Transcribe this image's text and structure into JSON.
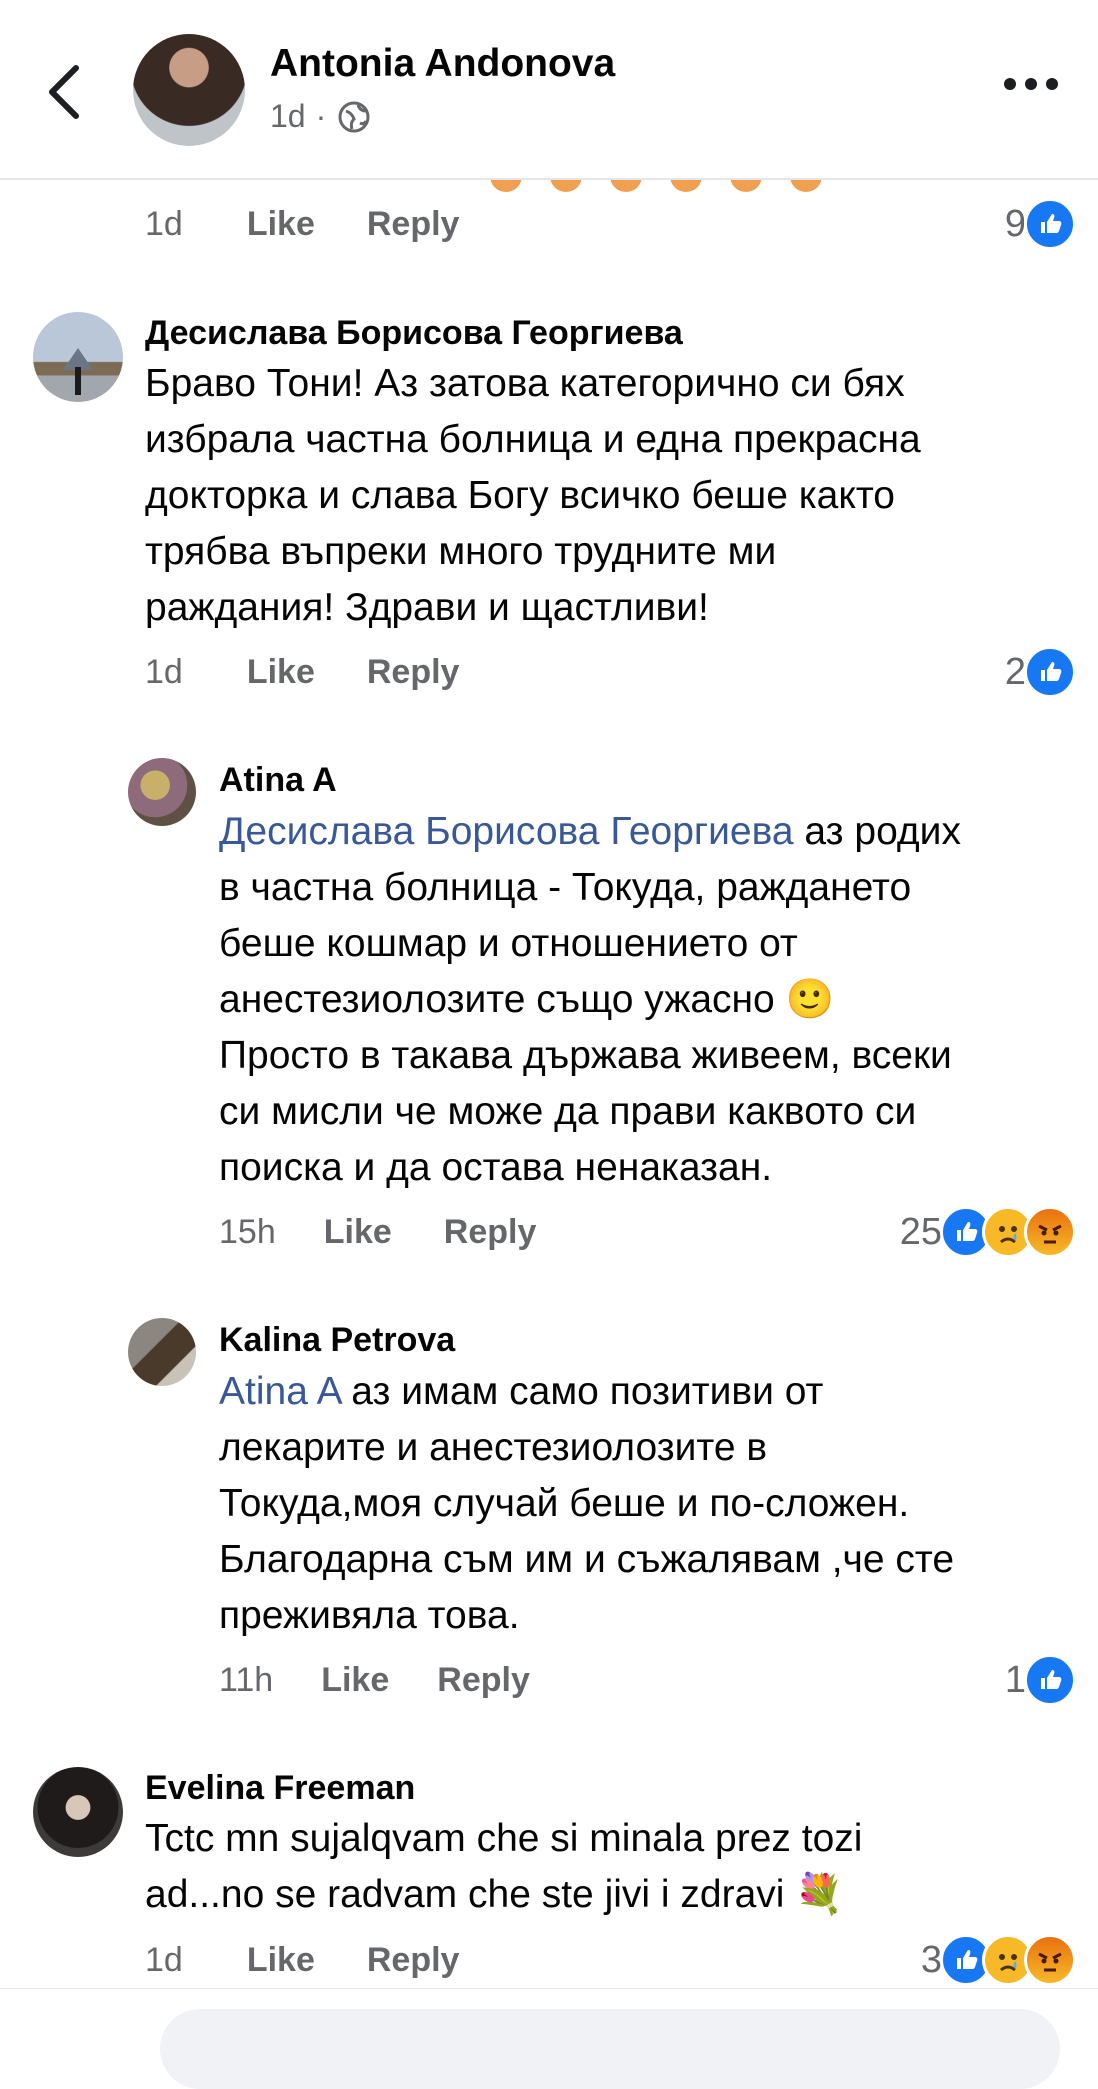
{
  "header": {
    "author": "Antonia Andonova",
    "time": "1d",
    "separator": "·",
    "privacy_icon": "globe-icon",
    "back_icon": "chevron-left-icon",
    "more_icon": "more-dots-icon"
  },
  "top_comment": {
    "time": "1d",
    "like": "Like",
    "reply": "Reply",
    "reaction_count": "9"
  },
  "comments": [
    {
      "author": "Десислава Борисова Георгиева",
      "lines": [
        "Браво Тони! Аз затова категорично си бях",
        "избрала частна болница и една прекрасна",
        "докторка и слава Богу всичко беше както",
        "трябва въпреки много трудните ми",
        "раждания! Здрави и щастливи!"
      ],
      "time": "1d",
      "like": "Like",
      "reply": "Reply",
      "reaction_count": "2"
    },
    {
      "author": "Atina A",
      "mention": "Десислава Борисова Георгиева",
      "first_line_rest": " аз родих",
      "lines": [
        "в частна болница - Токуда, раждането",
        "беше кошмар и отношението от",
        "анестезиолозите също ужасно 🙂",
        "Просто в такава държава живеем, всеки",
        "си мисли че може да прави каквото си",
        "поиска и да остава ненаказан."
      ],
      "time": "15h",
      "like": "Like",
      "reply": "Reply",
      "reaction_count": "25"
    },
    {
      "author": "Kalina Petrova",
      "mention": "Atina A",
      "first_line_rest": " аз имам само позитиви от",
      "lines": [
        "лекарите и анестезиолозите в",
        "Токуда,моя случай беше и по-сложен.",
        "Благодарна съм им и съжалявам ,че сте",
        "преживяла това."
      ],
      "time": "11h",
      "like": "Like",
      "reply": "Reply",
      "reaction_count": "1"
    },
    {
      "author": "Evelina Freeman",
      "lines": [
        "Tctc mn sujalqvam che si minala prez tozi",
        "ad...no se radvam che ste jivi i zdravi 💐"
      ],
      "time": "1d",
      "like": "Like",
      "reply": "Reply",
      "reaction_count": "3"
    }
  ],
  "colors": {
    "mention": "#385898",
    "like_blue": "#1877f2",
    "secondary_text": "#65676b"
  }
}
